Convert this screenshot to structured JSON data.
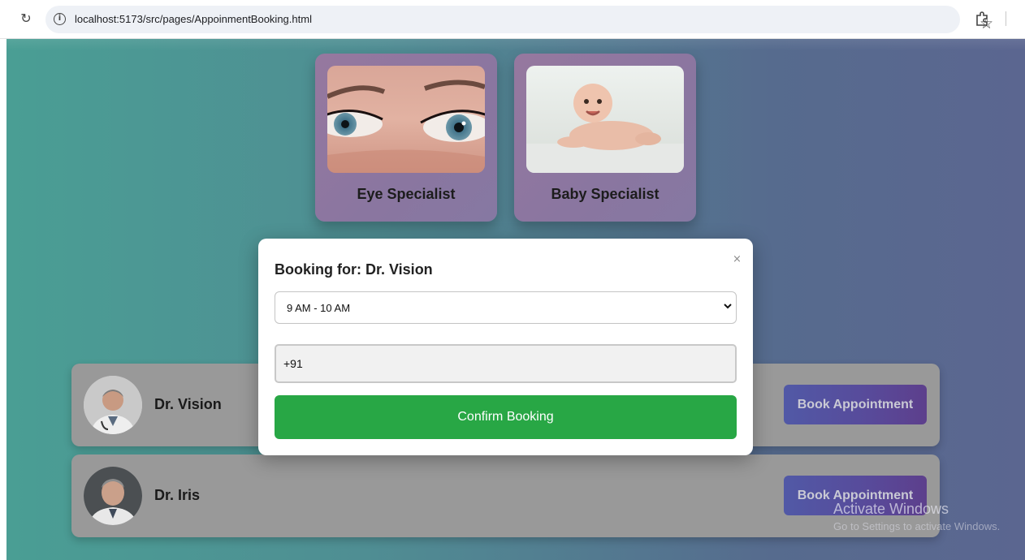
{
  "browser": {
    "url": "localhost:5173/src/pages/AppoinmentBooking.html",
    "icons": [
      "reload-icon",
      "info-icon",
      "star-icon",
      "extensions-icon"
    ]
  },
  "specialists": [
    {
      "label": "Eye Specialist",
      "image_icon": "eyes-photo"
    },
    {
      "label": "Baby Specialist",
      "image_icon": "baby-photo"
    }
  ],
  "doctors": [
    {
      "name": "Dr. Vision",
      "button_label": "Book Appointment"
    },
    {
      "name": "Dr. Iris",
      "button_label": "Book Appointment"
    }
  ],
  "modal": {
    "title": "Booking for: Dr. Vision",
    "close": "×",
    "time_slot_selected": "9 AM - 10 AM",
    "phone_value": "+91",
    "confirm_label": "Confirm Booking"
  },
  "watermark": {
    "title": "Activate Windows",
    "subtitle": "Go to Settings to activate Windows."
  },
  "colors": {
    "confirm_green": "#28a745",
    "book_button": "#584a9a",
    "card_purple": "#8a76a0"
  }
}
